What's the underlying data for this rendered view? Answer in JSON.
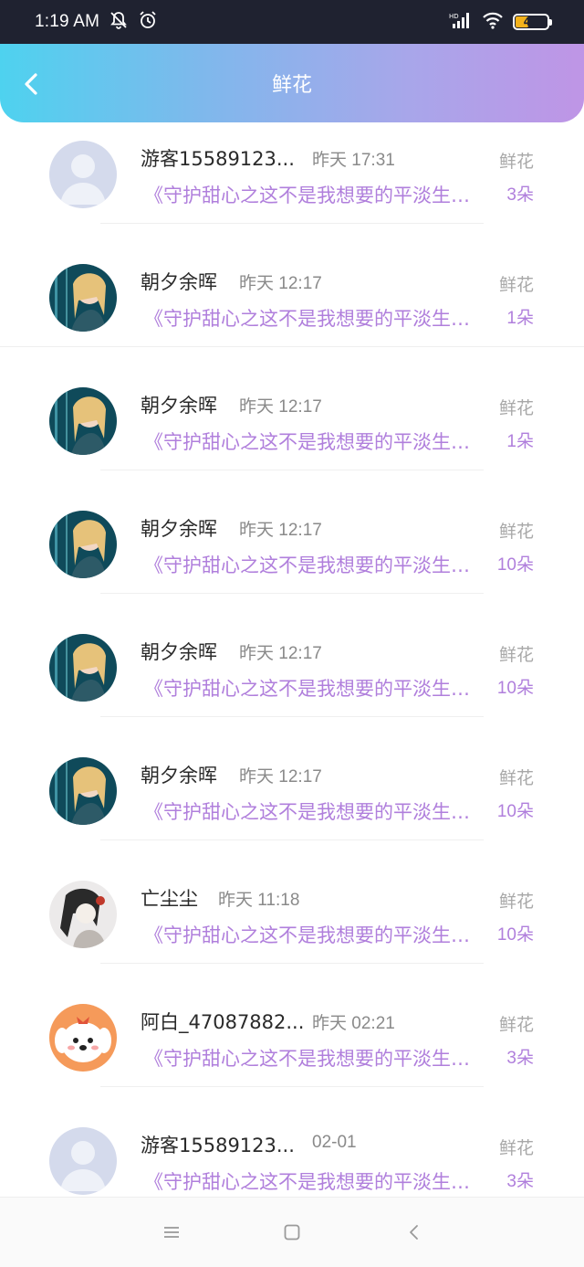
{
  "status_bar": {
    "time": "1:19 AM",
    "battery": "41",
    "icons": [
      "bell-off-icon",
      "alarm-icon",
      "hd-signal-icon",
      "wifi-icon",
      "battery-icon"
    ]
  },
  "header": {
    "title": "鲜花",
    "back_icon": "chevron-left-icon"
  },
  "colors": {
    "gradient_start": "#4ed2ef",
    "gradient_end": "#bf95e6",
    "accent_purple": "#b07fdc"
  },
  "records": [
    {
      "name": "游客15589123...",
      "time": "昨天 17:31",
      "book": "《守护甜心之这不是我想要的平淡生活》",
      "gift": "鲜花",
      "count": "3朵",
      "avatar": "default-avatar"
    },
    {
      "name": "朝夕余晖",
      "time": "昨天 12:17",
      "book": "《守护甜心之这不是我想要的平淡生活》",
      "gift": "鲜花",
      "count": "1朵",
      "avatar": "anime-girl-avatar"
    },
    {
      "name": "朝夕余晖",
      "time": "昨天 12:17",
      "book": "《守护甜心之这不是我想要的平淡生活》",
      "gift": "鲜花",
      "count": "1朵",
      "avatar": "anime-girl-avatar"
    },
    {
      "name": "朝夕余晖",
      "time": "昨天 12:17",
      "book": "《守护甜心之这不是我想要的平淡生活》",
      "gift": "鲜花",
      "count": "10朵",
      "avatar": "anime-girl-avatar"
    },
    {
      "name": "朝夕余晖",
      "time": "昨天 12:17",
      "book": "《守护甜心之这不是我想要的平淡生活》",
      "gift": "鲜花",
      "count": "10朵",
      "avatar": "anime-girl-avatar"
    },
    {
      "name": "朝夕余晖",
      "time": "昨天 12:17",
      "book": "《守护甜心之这不是我想要的平淡生活》",
      "gift": "鲜花",
      "count": "10朵",
      "avatar": "anime-girl-avatar"
    },
    {
      "name": "亡尘尘",
      "time": "昨天 11:18",
      "book": "《守护甜心之这不是我想要的平淡生活》",
      "gift": "鲜花",
      "count": "10朵",
      "avatar": "sketch-character-avatar"
    },
    {
      "name": "阿白_47087882...",
      "time": "昨天 02:21",
      "book": "《守护甜心之这不是我想要的平淡生活》",
      "gift": "鲜花",
      "count": "3朵",
      "avatar": "cartoon-dog-avatar"
    },
    {
      "name": "游客15589123...",
      "time": "02-01",
      "book": "《守护甜心之这不是我想要的平淡生活》",
      "gift": "鲜花",
      "count": "3朵",
      "avatar": "default-avatar"
    }
  ],
  "navbar": {
    "icons": [
      "menu-icon",
      "home-square-icon",
      "back-triangle-icon"
    ]
  }
}
